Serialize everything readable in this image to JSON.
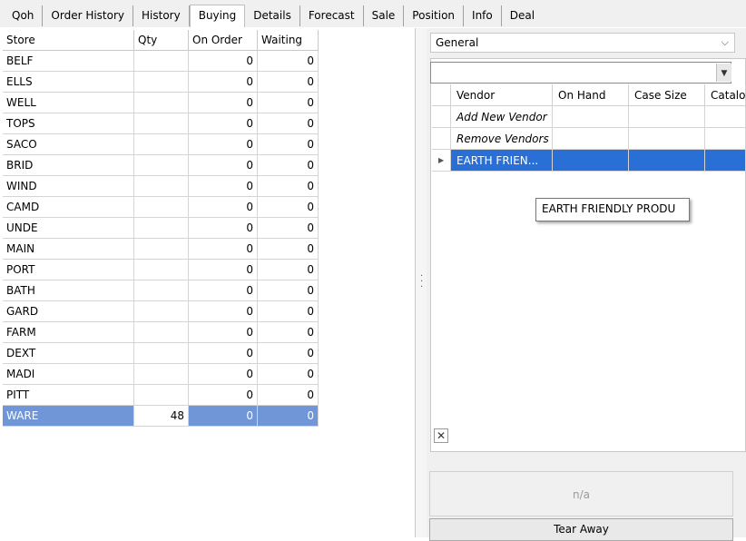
{
  "tabs": [
    "Qoh",
    "Order History",
    "History",
    "Buying",
    "Details",
    "Forecast",
    "Sale",
    "Position",
    "Info",
    "Deal"
  ],
  "active_tab": "Buying",
  "store_grid": {
    "columns": [
      "Store",
      "Qty",
      "On Order",
      "Waiting"
    ],
    "rows": [
      {
        "store": "BELF",
        "qty": "",
        "on_order": "0",
        "waiting": "0"
      },
      {
        "store": "ELLS",
        "qty": "",
        "on_order": "0",
        "waiting": "0"
      },
      {
        "store": "WELL",
        "qty": "",
        "on_order": "0",
        "waiting": "0"
      },
      {
        "store": "TOPS",
        "qty": "",
        "on_order": "0",
        "waiting": "0"
      },
      {
        "store": "SACO",
        "qty": "",
        "on_order": "0",
        "waiting": "0"
      },
      {
        "store": "BRID",
        "qty": "",
        "on_order": "0",
        "waiting": "0"
      },
      {
        "store": "WIND",
        "qty": "",
        "on_order": "0",
        "waiting": "0"
      },
      {
        "store": "CAMD",
        "qty": "",
        "on_order": "0",
        "waiting": "0"
      },
      {
        "store": "UNDE",
        "qty": "",
        "on_order": "0",
        "waiting": "0"
      },
      {
        "store": "MAIN",
        "qty": "",
        "on_order": "0",
        "waiting": "0"
      },
      {
        "store": "PORT",
        "qty": "",
        "on_order": "0",
        "waiting": "0"
      },
      {
        "store": "BATH",
        "qty": "",
        "on_order": "0",
        "waiting": "0"
      },
      {
        "store": "GARD",
        "qty": "",
        "on_order": "0",
        "waiting": "0"
      },
      {
        "store": "FARM",
        "qty": "",
        "on_order": "0",
        "waiting": "0"
      },
      {
        "store": "DEXT",
        "qty": "",
        "on_order": "0",
        "waiting": "0"
      },
      {
        "store": "MADI",
        "qty": "",
        "on_order": "0",
        "waiting": "0"
      },
      {
        "store": "PITT",
        "qty": "",
        "on_order": "0",
        "waiting": "0"
      },
      {
        "store": "WARE",
        "qty": "48",
        "on_order": "0",
        "waiting": "0"
      }
    ]
  },
  "right_panel": {
    "category_select": "General",
    "vendor_grid": {
      "columns": [
        "Vendor",
        "On Hand",
        "Case Size",
        "Catalo"
      ],
      "rows": [
        "Add New Vendor",
        "Remove Vendors",
        "EARTH FRIEN..."
      ]
    },
    "tooltip": "EARTH FRIENDLY PRODU",
    "close_glyph": "✕",
    "na_label": "n/a",
    "tear_away_label": "Tear Away"
  },
  "colors": {
    "selection_row": "#7096d8",
    "vendor_selection": "#2a6fd6"
  }
}
